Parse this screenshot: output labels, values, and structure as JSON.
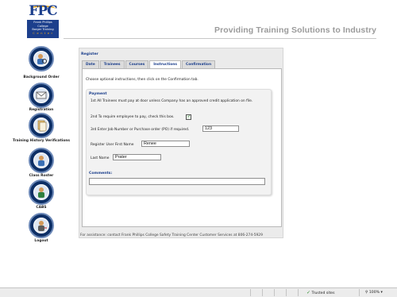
{
  "header": {
    "logo_text": "FPC",
    "logo_sub_lines": [
      "Frank Phillips",
      "College",
      "Borger Training",
      "C e n t e r"
    ],
    "tagline": "Providing Training Solutions to Industry"
  },
  "sidebar": {
    "items": [
      {
        "label": "Background Order",
        "icon": "background-check-icon"
      },
      {
        "label": "Registration",
        "icon": "envelope-icon"
      },
      {
        "label": "Training History Verifications",
        "icon": "document-stack-icon"
      },
      {
        "label": "Class Roster",
        "icon": "person-icon"
      },
      {
        "label": "CABS",
        "icon": "person-icon"
      },
      {
        "label": "Logout",
        "icon": "logout-icon"
      }
    ]
  },
  "main": {
    "section_label": "Register",
    "tabs": [
      {
        "label": "Date",
        "active": false
      },
      {
        "label": "Trainees",
        "active": false
      },
      {
        "label": "Courses",
        "active": false
      },
      {
        "label": "Instructions",
        "active": true
      },
      {
        "label": "Confirmation",
        "active": false
      }
    ],
    "instructions_text": "Choose optional instructions, then click on the Confirmation tab.",
    "payment": {
      "title": "Payment",
      "line1": "1st All Trainees must pay at door unless Company has an approved credit application on file.",
      "line2": "2nd To require employee to pay, check this box.",
      "checkbox_checked": true,
      "line3": "3rd Enter Job Number or Purchase order (PO) if required.",
      "po_value": "123",
      "first_name_label": "Register User First Name",
      "first_name_value": "Renee",
      "last_name_label": "Last Name",
      "last_name_value": "Prater",
      "comments_label": "Comments:",
      "comments_value": ""
    },
    "footer_note": "For assistance: contact Frank Phillips College Safety Training Center Customer Services at 806-274-5929"
  },
  "statusbar": {
    "zone": "Trusted sites",
    "zoom": "100%"
  }
}
